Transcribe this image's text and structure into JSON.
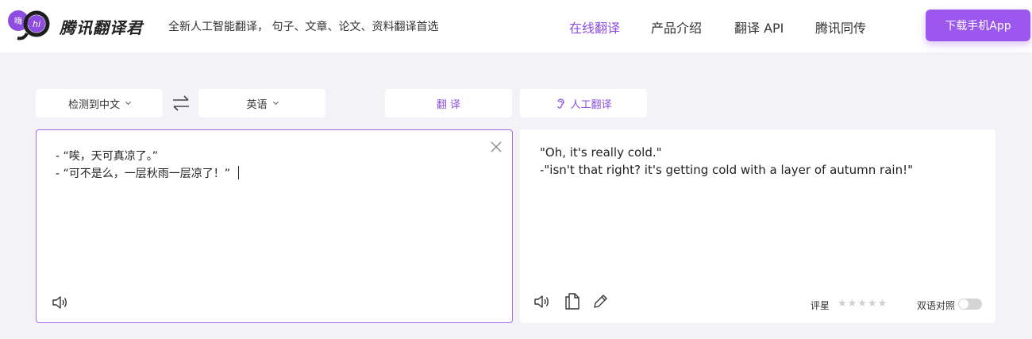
{
  "header": {
    "logo_text": "嗨 hi",
    "brand": "腾讯翻译君",
    "tagline": "全新人工智能翻译， 句子、文章、论文、资料翻译首选",
    "nav": [
      {
        "label": "在线翻译",
        "active": true
      },
      {
        "label": "产品介绍",
        "active": false
      },
      {
        "label": "翻译 API",
        "active": false
      },
      {
        "label": "腾讯同传",
        "active": false
      }
    ],
    "download_label": "下载手机App"
  },
  "toolbar": {
    "source_lang": "检测到中文",
    "target_lang": "英语",
    "translate_label": "翻 译",
    "human_translate_label": "人工翻译"
  },
  "source": {
    "lines": [
      "- “唉，天可真凉了。”",
      "- “可不是么，一层秋雨一层凉了！”"
    ]
  },
  "target": {
    "lines": [
      "\"Oh, it's really cold.\"",
      "-\"isn't that right? it's getting cold with a layer of autumn rain!\""
    ]
  },
  "footer": {
    "rate_label": "评星",
    "stars": "★★★★★",
    "bilingual_label": "双语对照"
  },
  "colors": {
    "accent": "#8d4ee0",
    "button": "#9b57ee",
    "background": "#f3f3f7"
  }
}
